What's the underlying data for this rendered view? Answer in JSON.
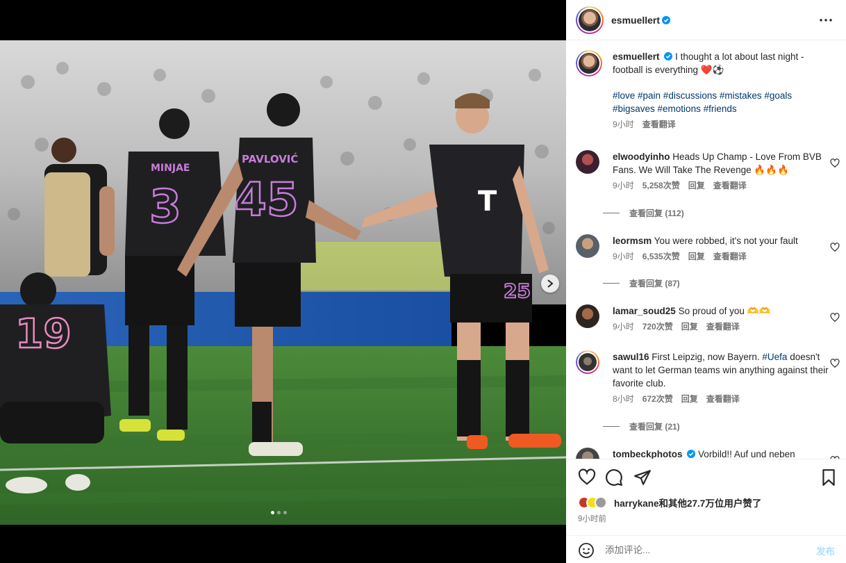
{
  "post": {
    "username": "esmuellert",
    "caption_text": "I thought a lot about last night - football is everything ❤️⚽",
    "hashtags": "#love #pain #discussions #mistakes #goals #bigsaves #emotions #friends",
    "caption_time": "9小时",
    "translate": "查看翻译"
  },
  "comments": [
    {
      "username": "elwoodyinho",
      "text": "Heads Up Champ - Love From BVB Fans. We Will Take The Revenge 🔥🔥🔥",
      "time": "9小时",
      "likes": "5,258次赞",
      "reply": "回复",
      "translate": "查看翻译",
      "view_replies": "查看回复 (112)"
    },
    {
      "username": "leormsm",
      "text": "You were robbed, it's not your fault",
      "time": "9小时",
      "likes": "6,535次赞",
      "reply": "回复",
      "translate": "查看翻译",
      "view_replies": "查看回复 (87)"
    },
    {
      "username": "lamar_soud25",
      "text": "So proud of you 🫶🫶",
      "time": "9小时",
      "likes": "720次赞",
      "reply": "回复",
      "translate": "查看翻译"
    },
    {
      "username": "sawul16",
      "text_before": "First Leipzig, now Bayern.",
      "text_tag": "#Uefa",
      "text_after": "doesn't want to let German teams win anything against their favorite club.",
      "time": "8小时",
      "likes": "672次赞",
      "reply": "回复",
      "translate": "查看翻译",
      "view_replies": "查看回复 (21)"
    },
    {
      "username": "tombeckphotos",
      "text": "Vorbild!! Auf und neben"
    }
  ],
  "likes_text": "harrykane和其他27.7万位用户赞了",
  "post_time": "9小时前",
  "composer": {
    "placeholder": "添加评论...",
    "post_label": "发布"
  },
  "photo": {
    "players": [
      {
        "name": "MINJAE",
        "number": "3"
      },
      {
        "name": "PAVLOVIĆ",
        "number": "45"
      },
      {
        "number": "19"
      },
      {
        "number": "25"
      }
    ]
  },
  "colors": {
    "link": "#00376b",
    "muted": "#737373",
    "kit_accent": "#c77dd8",
    "pitch": "#3f7a32"
  },
  "carousel": {
    "slides": 3,
    "active": 1
  }
}
